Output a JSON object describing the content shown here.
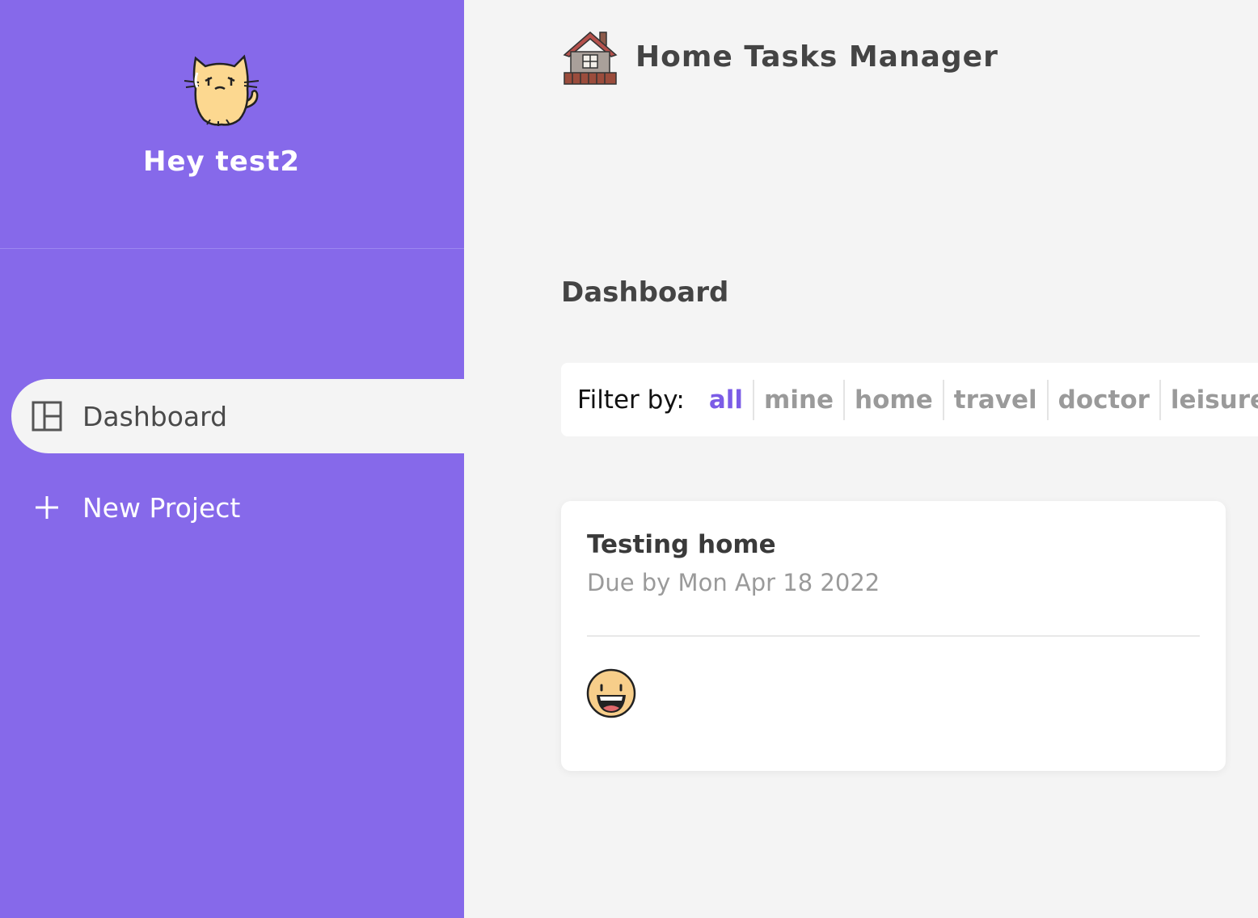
{
  "sidebar": {
    "greeting": "Hey test2",
    "avatar_icon": "cat-avatar-icon",
    "nav": [
      {
        "label": "Dashboard",
        "icon": "dashboard-icon",
        "active": true
      },
      {
        "label": "New Project",
        "icon": "plus-icon",
        "active": false
      }
    ]
  },
  "header": {
    "title": "Home Tasks Manager",
    "icon": "house-icon"
  },
  "main": {
    "page_title": "Dashboard",
    "filter": {
      "label": "Filter by:",
      "options": [
        "all",
        "mine",
        "home",
        "travel",
        "doctor",
        "leisure"
      ],
      "selected": "all"
    },
    "tasks": [
      {
        "title": "Testing home",
        "due": "Due by Mon Apr 18 2022",
        "assignee_icon": "grinning-face-icon"
      }
    ]
  },
  "colors": {
    "sidebar_bg": "#8669ea",
    "main_bg": "#f4f4f4",
    "accent": "#7b5ce6",
    "text_dark": "#444444",
    "text_muted": "#9a9a9a"
  }
}
